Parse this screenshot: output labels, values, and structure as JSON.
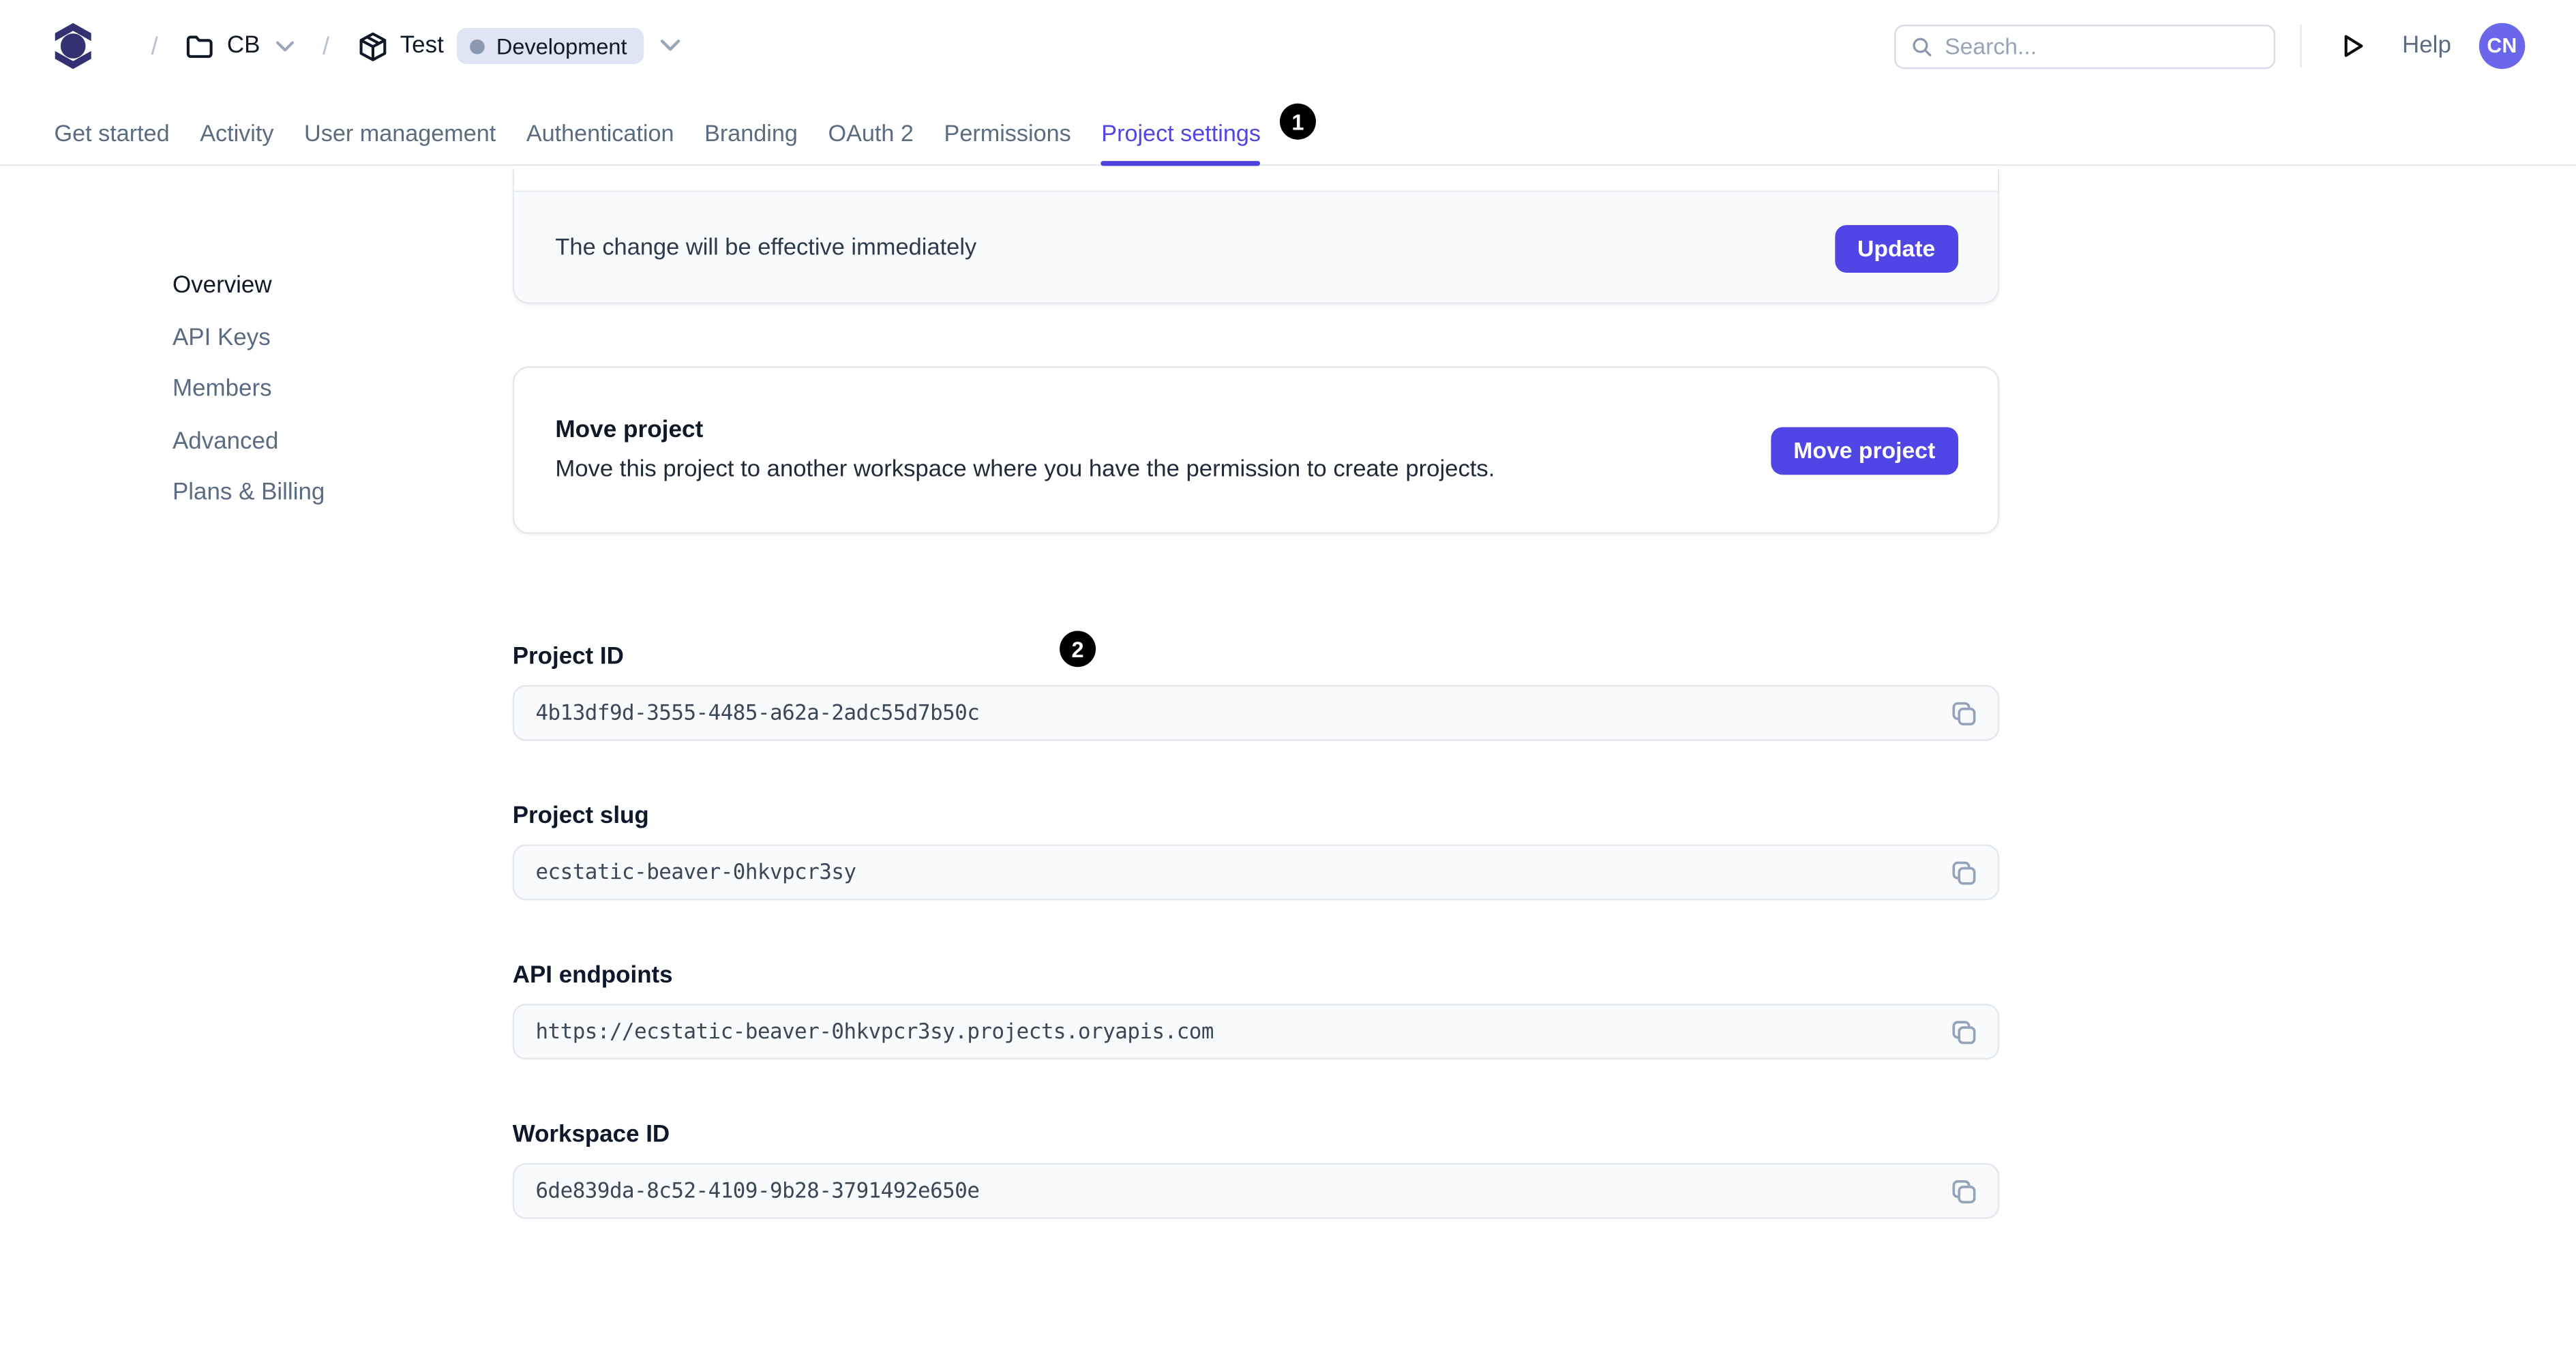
{
  "header": {
    "workspace": "CB",
    "project": "Test",
    "environment": "Development",
    "search_placeholder": "Search...",
    "help_label": "Help",
    "avatar_initials": "CN"
  },
  "tabs": {
    "items": [
      "Get started",
      "Activity",
      "User management",
      "Authentication",
      "Branding",
      "OAuth 2",
      "Permissions",
      "Project settings"
    ],
    "active": "Project settings"
  },
  "annotations": {
    "marks": [
      {
        "number": "1"
      },
      {
        "number": "2"
      }
    ]
  },
  "sidebar": {
    "items": [
      "Overview",
      "API Keys",
      "Members",
      "Advanced",
      "Plans & Billing"
    ],
    "active": "Overview"
  },
  "main": {
    "update_card": {
      "note": "The change will be effective immediately",
      "button": "Update"
    },
    "move_card": {
      "title": "Move project",
      "description": "Move this project to another workspace where you have the permission to create projects.",
      "button": "Move project"
    },
    "fields": [
      {
        "label": "Project ID",
        "value": "4b13df9d-3555-4485-a62a-2adc55d7b50c"
      },
      {
        "label": "Project slug",
        "value": "ecstatic-beaver-0hkvpcr3sy"
      },
      {
        "label": "API endpoints",
        "value": "https://ecstatic-beaver-0hkvpcr3sy.projects.oryapis.com"
      },
      {
        "label": "Workspace ID",
        "value": "6de839da-8c52-4109-9b28-3791492e650e"
      }
    ]
  },
  "icons": {
    "logo": "ory-logo",
    "workspace": "folder-icon",
    "project": "package-icon",
    "search": "search-icon",
    "run": "play-icon",
    "copy": "copy-icon",
    "expand": "chevron-down-icon"
  },
  "colors": {
    "accent": "#4f46e5",
    "logo": "#343173",
    "avatar": "#6b67ea",
    "badge_bg": "#dfe5f4",
    "badge_dot": "#8b99b0",
    "tab_inactive": "#5b6b80",
    "field_bg": "#f8fafc",
    "border": "#e5e8ee",
    "mark_bg": "#000000"
  }
}
